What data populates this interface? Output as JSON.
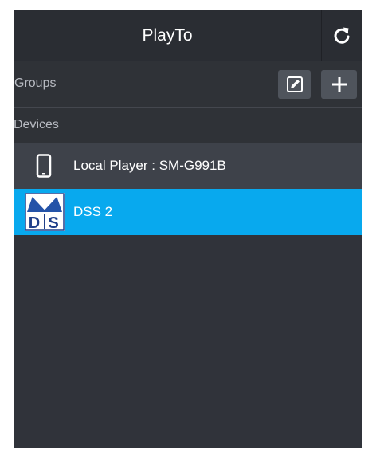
{
  "app": {
    "title": "PlayTo"
  },
  "groups": {
    "label": "Groups"
  },
  "devices": {
    "label": "Devices",
    "items": [
      {
        "label": "Local Player : SM-G991B",
        "icon": "phone-icon",
        "selected": false
      },
      {
        "label": "DSS 2",
        "icon": "dss-logo",
        "logo_text": "MDS",
        "selected": true
      }
    ]
  },
  "colors": {
    "background": "#30333a",
    "titlebar": "#2a2d33",
    "selected": "#08a9ee",
    "button": "#4f545c"
  },
  "icons": {
    "refresh": "refresh-icon",
    "edit": "edit-icon",
    "add": "plus-icon"
  }
}
